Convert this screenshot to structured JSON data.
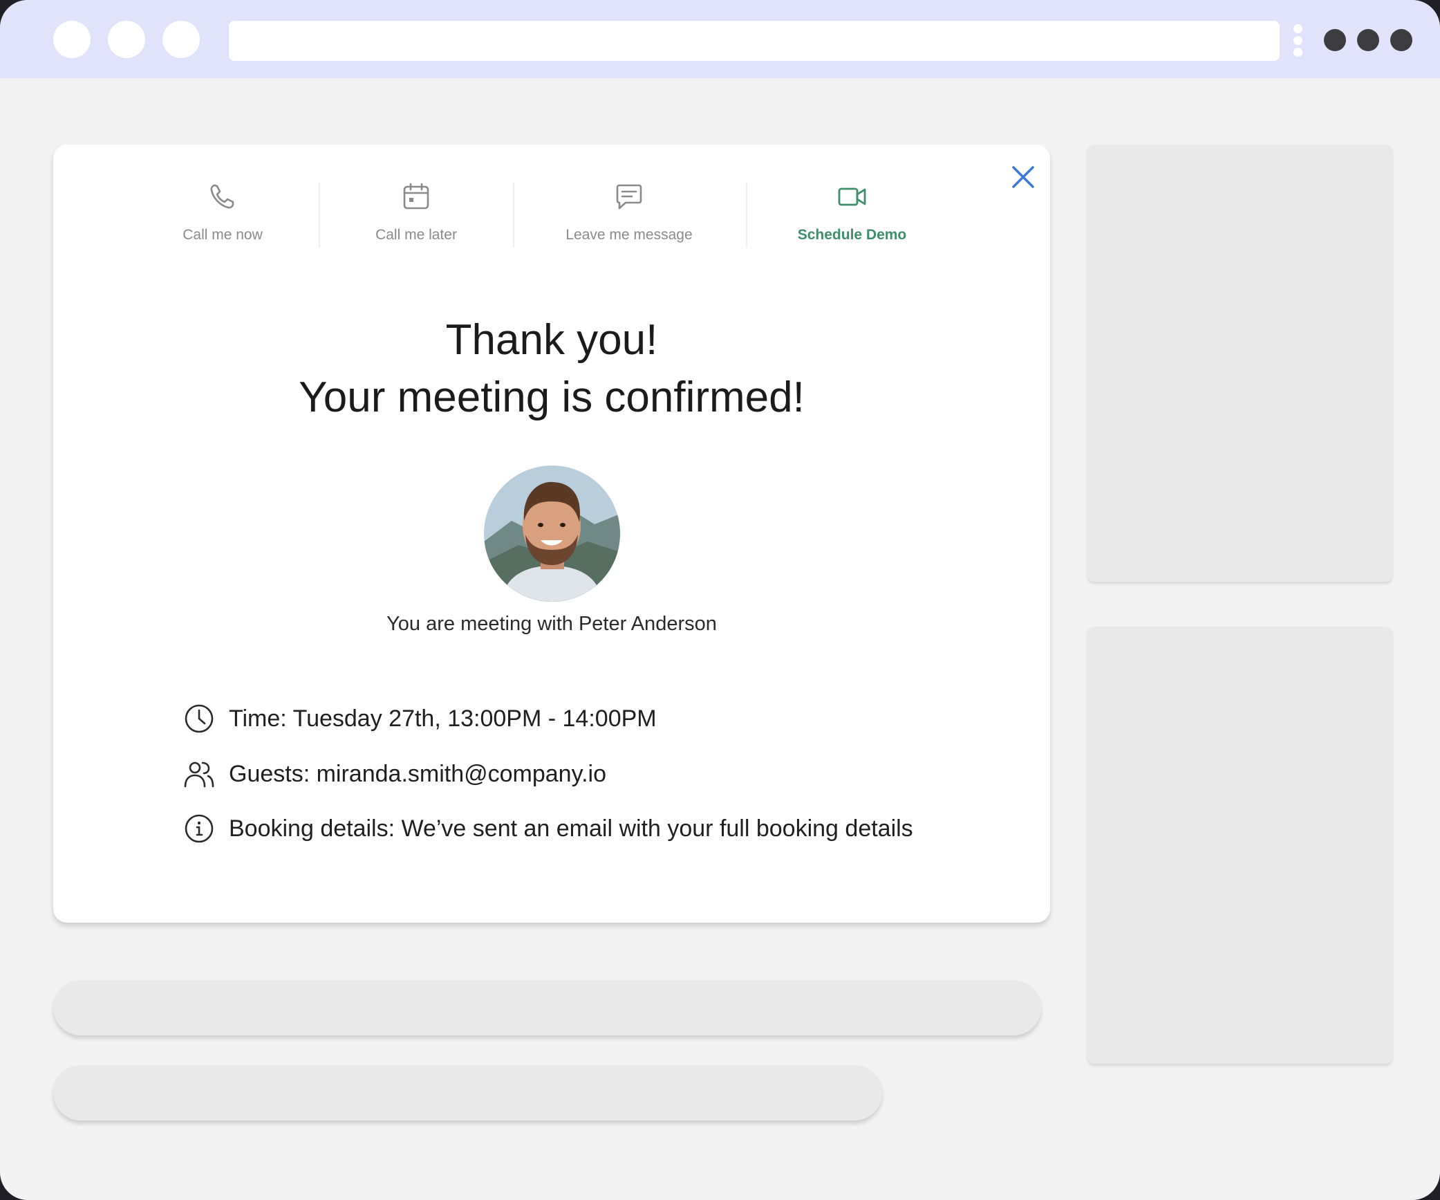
{
  "tabs": [
    {
      "label": "Call me now",
      "icon": "phone-icon",
      "active": false
    },
    {
      "label": "Call me later",
      "icon": "calendar-icon",
      "active": false
    },
    {
      "label": "Leave me message",
      "icon": "message-icon",
      "active": false
    },
    {
      "label": "Schedule Demo",
      "icon": "video-camera-icon",
      "active": true
    }
  ],
  "confirmation": {
    "title_line1": "Thank you!",
    "title_line2": "Your meeting is confirmed!",
    "meeting_with": "You are meeting with Peter Anderson"
  },
  "details": {
    "time": "Time: Tuesday 27th, 13:00PM - 14:00PM",
    "guests": "Guests: miranda.smith@company.io",
    "booking": "Booking details: We’ve sent an email with your full booking details"
  },
  "colors": {
    "accent_green": "#3d8f6b",
    "close_blue": "#3b78d8",
    "titlebar": "#e1e2fb",
    "inactive_tab": "#8a8a8a"
  }
}
